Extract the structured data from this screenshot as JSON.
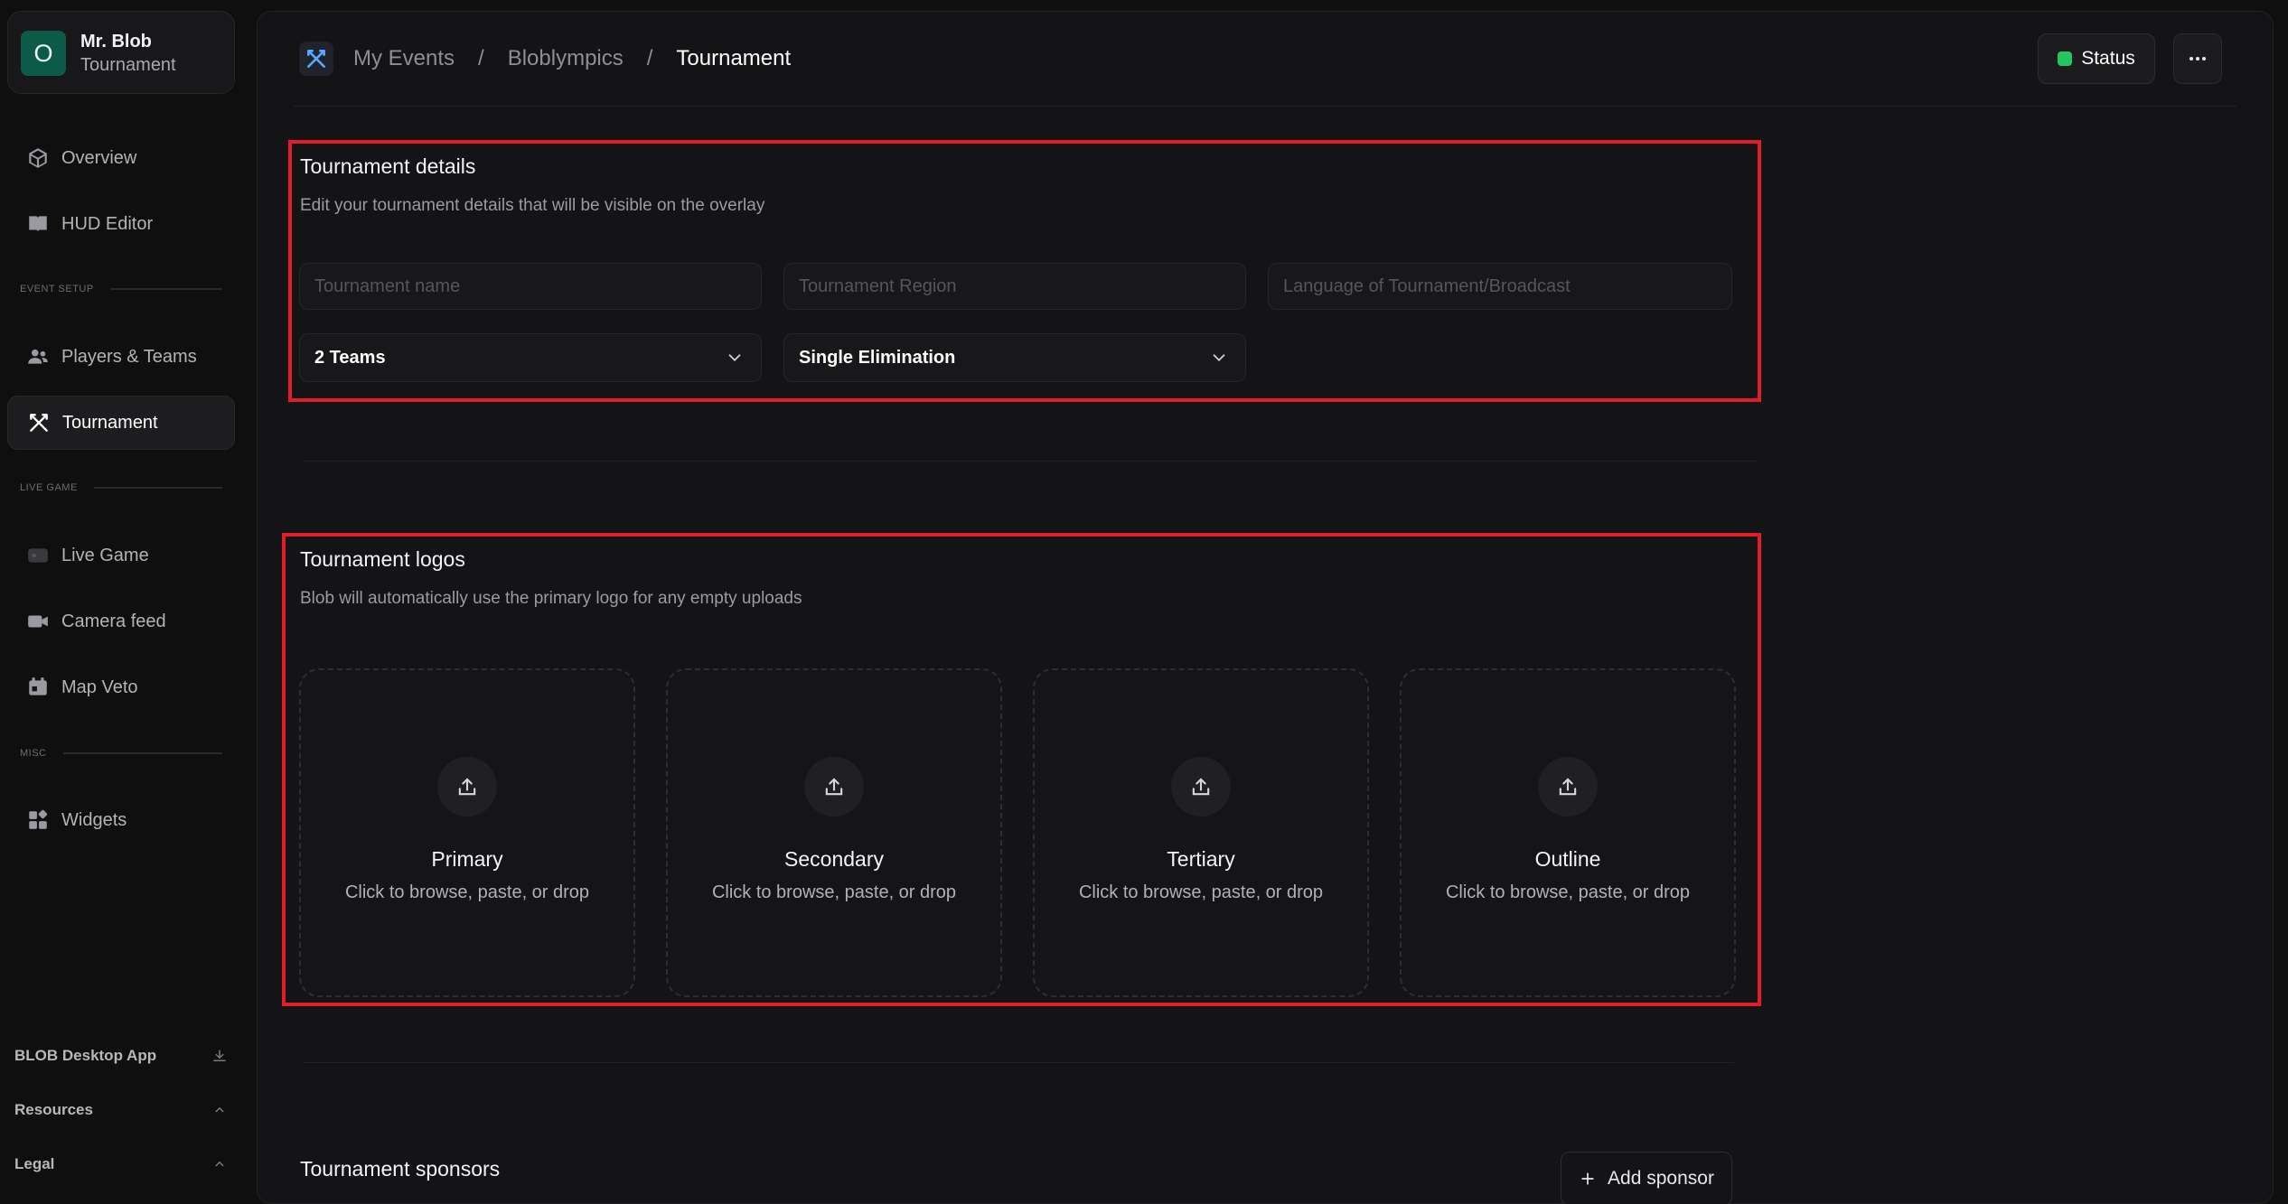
{
  "org": {
    "avatar_letter": "O",
    "name": "Mr. Blob",
    "subtitle": "Tournament"
  },
  "sidebar": {
    "items": [
      {
        "label": "Overview",
        "icon": "cube-icon"
      },
      {
        "label": "HUD Editor",
        "icon": "book-icon"
      },
      {
        "label": "Players & Teams",
        "icon": "users-icon"
      },
      {
        "label": "Tournament",
        "icon": "swords-icon",
        "active": true
      },
      {
        "label": "Live Game",
        "icon": "gamepad-icon"
      },
      {
        "label": "Camera feed",
        "icon": "video-icon"
      },
      {
        "label": "Map Veto",
        "icon": "map-icon"
      },
      {
        "label": "Widgets",
        "icon": "widgets-icon"
      }
    ],
    "sections": {
      "event_setup": "EVENT SETUP",
      "live_game": "LIVE GAME",
      "misc": "MISC"
    },
    "footer": [
      {
        "label": "BLOB Desktop App",
        "icon": "download-icon"
      },
      {
        "label": "Resources",
        "icon": "chevron-up-icon"
      },
      {
        "label": "Legal",
        "icon": "chevron-up-icon"
      }
    ]
  },
  "breadcrumb": {
    "items": [
      "My Events",
      "Bloblympics"
    ],
    "current": "Tournament",
    "separator": "/"
  },
  "header": {
    "status_label": "Status",
    "status_color": "#22c55e"
  },
  "details": {
    "title": "Tournament details",
    "description": "Edit your tournament details that will be visible on the overlay",
    "name_placeholder": "Tournament name",
    "region_placeholder": "Tournament Region",
    "language_placeholder": "Language of Tournament/Broadcast",
    "teams_value": "2 Teams",
    "format_value": "Single Elimination"
  },
  "logos": {
    "title": "Tournament logos",
    "description": "Blob will automatically use the primary logo for any empty uploads",
    "slots": [
      {
        "title": "Primary",
        "hint": "Click to browse, paste, or drop"
      },
      {
        "title": "Secondary",
        "hint": "Click to browse, paste, or drop"
      },
      {
        "title": "Tertiary",
        "hint": "Click to browse, paste, or drop"
      },
      {
        "title": "Outline",
        "hint": "Click to browse, paste, or drop"
      }
    ]
  },
  "sponsors": {
    "title": "Tournament sponsors",
    "add_label": "Add sponsor"
  },
  "colors": {
    "highlight_box": "#e11d2a",
    "avatar_bg": "#0e5a49",
    "accent_icon": "#5aa7ff"
  }
}
